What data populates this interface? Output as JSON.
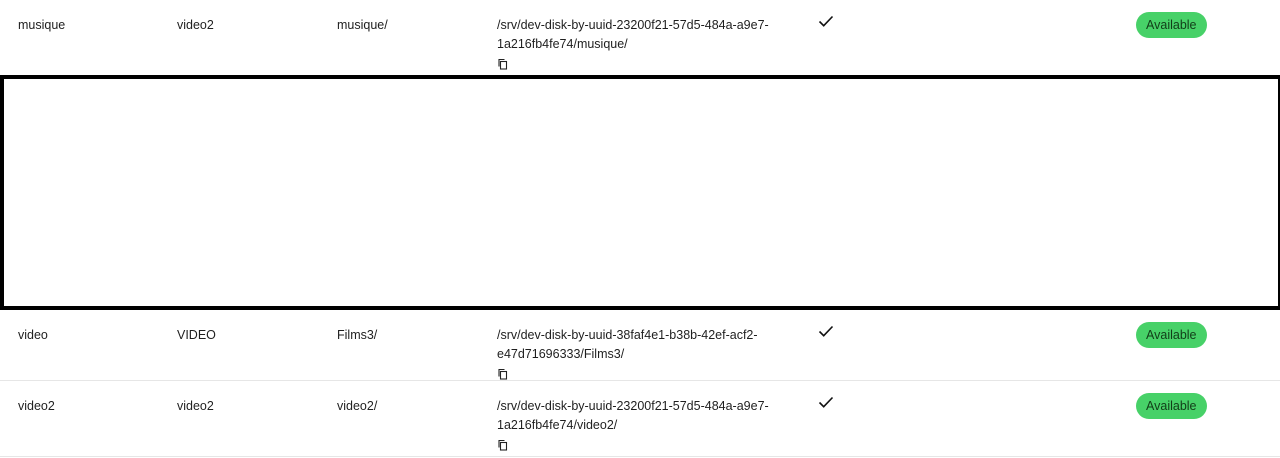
{
  "rows": [
    {
      "name": "musique",
      "device": "video2",
      "relative_path": "musique/",
      "absolute_path": "/srv/dev-disk-by-uuid-23200f21-57d5-484a-a9e7-1a216fb4fe74/musique/",
      "enabled_icon": "check-icon",
      "status": "Available"
    },
    {
      "name": "video",
      "device": "VIDEO",
      "relative_path": "Films3/",
      "absolute_path": "/srv/dev-disk-by-uuid-38faf4e1-b38b-42ef-acf2-e47d71696333/Films3/",
      "enabled_icon": "check-icon",
      "status": "Available"
    },
    {
      "name": "video2",
      "device": "video2",
      "relative_path": "video2/",
      "absolute_path": "/srv/dev-disk-by-uuid-23200f21-57d5-484a-a9e7-1a216fb4fe74/video2/",
      "enabled_icon": "check-icon",
      "status": "Available"
    }
  ],
  "colors": {
    "status_available": "#47d168",
    "frame_border": "#000000",
    "row_divider": "#e6e6e6"
  },
  "icons": {
    "copy": "copy-icon",
    "enabled": "check-icon"
  }
}
